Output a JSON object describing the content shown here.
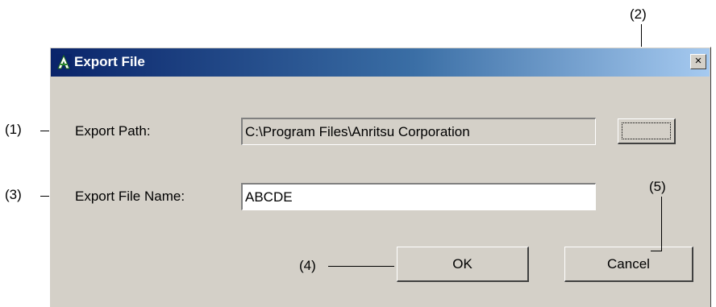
{
  "dialog": {
    "title": "Export File",
    "close_glyph": "×",
    "icon": "anritsu-logo-icon"
  },
  "export_path": {
    "label": "Export Path:",
    "value": "C:\\Program Files\\Anritsu Corporation"
  },
  "browse_button": {
    "label": ""
  },
  "export_file_name": {
    "label": "Export File Name:",
    "value": "ABCDE"
  },
  "buttons": {
    "ok": "OK",
    "cancel": "Cancel"
  },
  "callouts": {
    "c1": "(1)",
    "c2": "(2)",
    "c3": "(3)",
    "c4": "(4)",
    "c5": "(5)"
  },
  "colors": {
    "dialog_face": "#d4d0c8",
    "titlebar_start": "#0a246a",
    "titlebar_end": "#a6caf0"
  }
}
